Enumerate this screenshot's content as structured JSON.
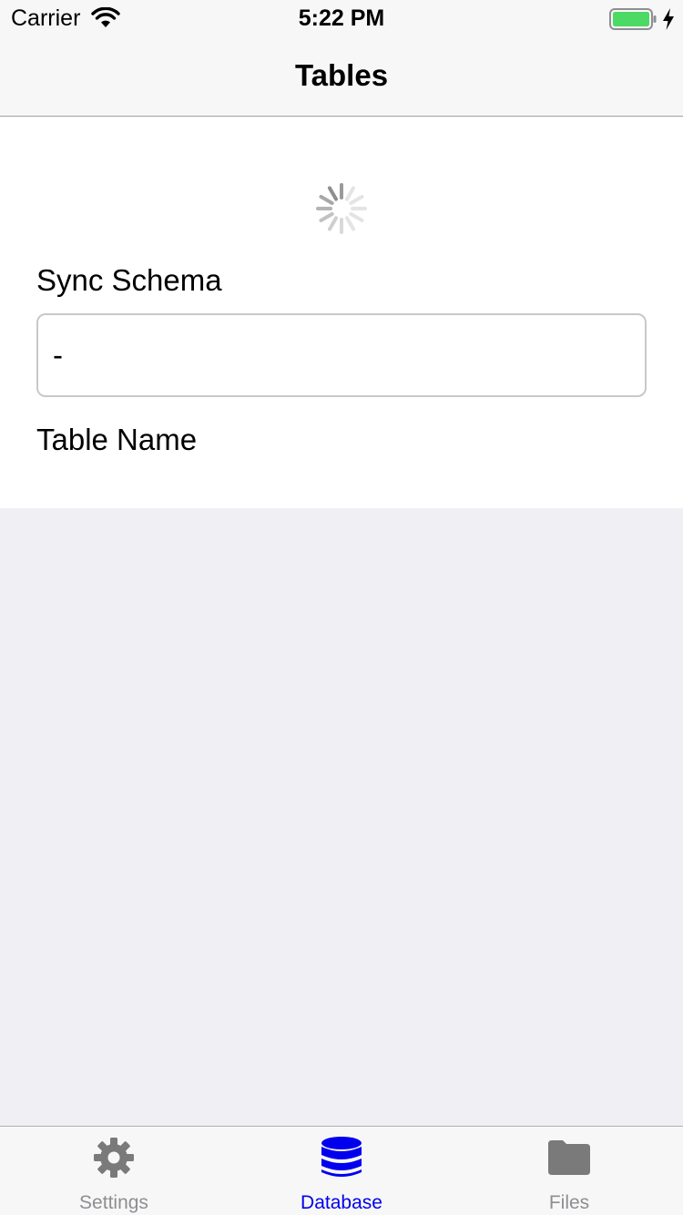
{
  "status_bar": {
    "carrier": "Carrier",
    "time": "5:22 PM"
  },
  "nav": {
    "title": "Tables"
  },
  "form": {
    "sync_schema_label": "Sync Schema",
    "sync_schema_value": "-",
    "table_name_label": "Table Name"
  },
  "tabs": [
    {
      "label": "Settings",
      "icon": "gear-icon",
      "selected": false
    },
    {
      "label": "Database",
      "icon": "database-icon",
      "selected": true
    },
    {
      "label": "Files",
      "icon": "folder-icon",
      "selected": false
    }
  ],
  "colors": {
    "accent": "#0000ee",
    "inactive_tab": "#8e8e93",
    "battery": "#4cd964",
    "background": "#efeff4"
  }
}
